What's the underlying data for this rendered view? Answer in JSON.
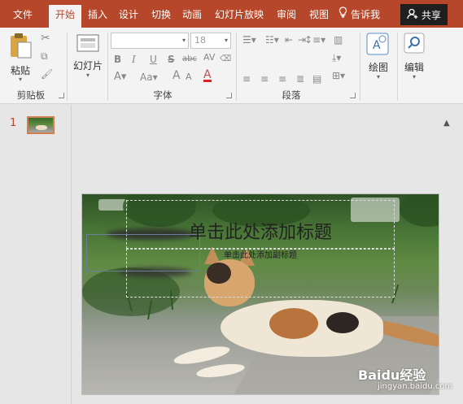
{
  "tabs": [
    {
      "id": "file",
      "label": "文件"
    },
    {
      "id": "home",
      "label": "开始",
      "active": true
    },
    {
      "id": "insert",
      "label": "插入"
    },
    {
      "id": "design",
      "label": "设计"
    },
    {
      "id": "transitions",
      "label": "切换"
    },
    {
      "id": "animations",
      "label": "动画"
    },
    {
      "id": "slideshow",
      "label": "幻灯片放映"
    },
    {
      "id": "review",
      "label": "审阅"
    },
    {
      "id": "view",
      "label": "视图"
    }
  ],
  "tell_me": "告诉我",
  "share": "共享",
  "ribbon": {
    "paste": "粘贴",
    "slides_btn": "幻灯片",
    "draw": "绘图",
    "edit": "编辑",
    "font_name": "",
    "font_size": "18",
    "groups": {
      "clipboard": "剪贴板",
      "font": "字体",
      "paragraph": "段落"
    },
    "font_buttons": [
      "B",
      "I",
      "U",
      "S",
      "abc",
      "AV"
    ]
  },
  "thumbnails": {
    "slide_number": "1"
  },
  "slide": {
    "title_placeholder": "单击此处添加标题",
    "subtitle_placeholder": "单击此处添加副标题"
  },
  "watermark": {
    "brand": "Baidu经验",
    "url": "jingyan.baidu.com"
  },
  "colors": {
    "accent": "#b7472a",
    "share_bg": "#1f1f1f",
    "ribbon_bg": "#f3f3f3",
    "selected_thumb_border": "#d0804f"
  }
}
